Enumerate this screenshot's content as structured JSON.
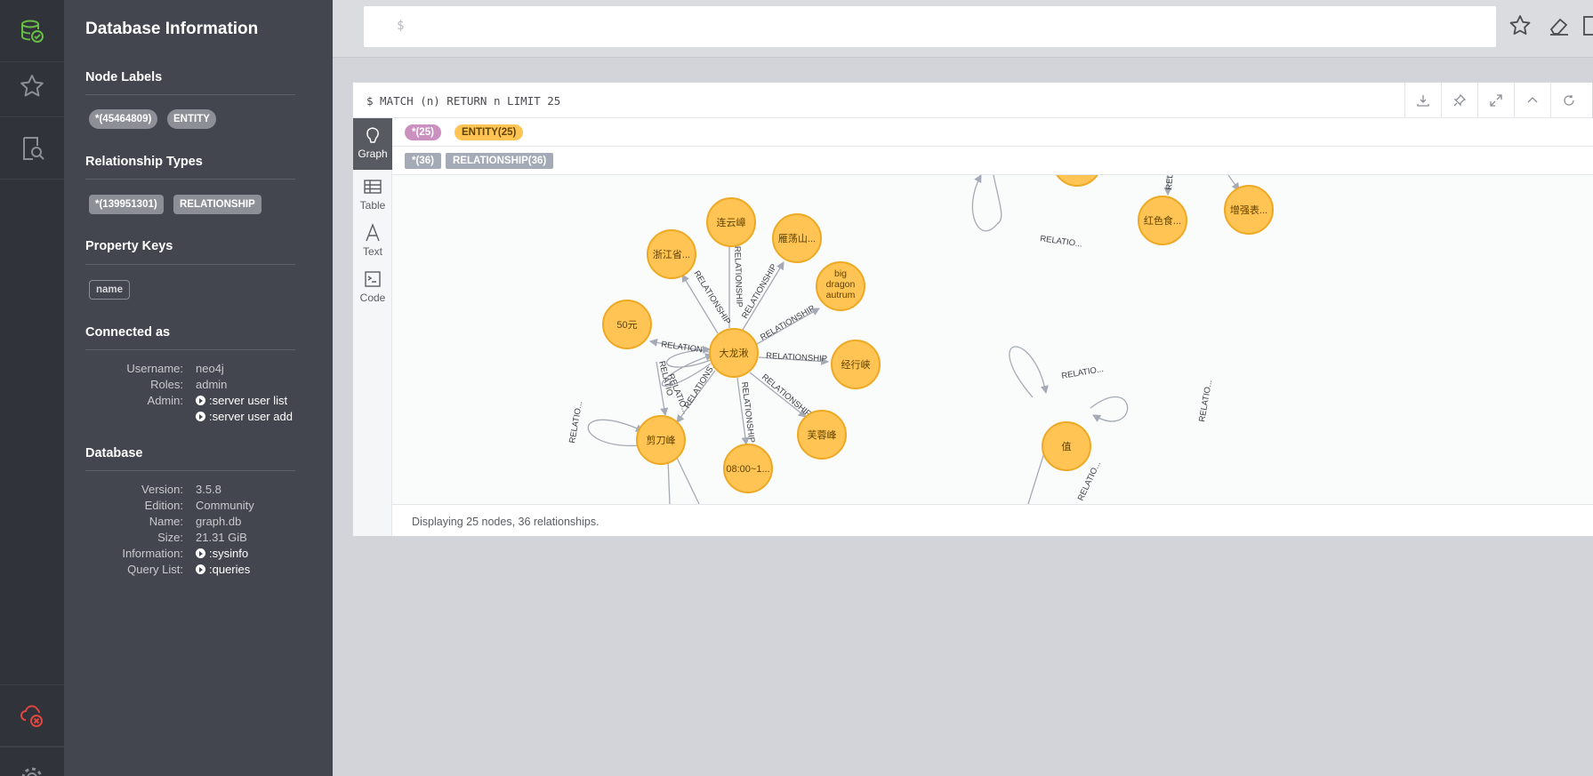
{
  "drawer": {
    "title": "Database Information",
    "node_labels_heading": "Node Labels",
    "node_labels": [
      "*(45464809)",
      "ENTITY"
    ],
    "relationship_types_heading": "Relationship Types",
    "relationship_types": [
      "*(139951301)",
      "RELATIONSHIP"
    ],
    "property_keys_heading": "Property Keys",
    "property_keys": [
      "name"
    ],
    "connected_heading": "Connected as",
    "connected": [
      {
        "k": "Username:",
        "v": "neo4j"
      },
      {
        "k": "Roles:",
        "v": "admin"
      },
      {
        "k": "Admin:",
        "v": ":server user list",
        "link": true
      },
      {
        "k": "",
        "v": ":server user add",
        "link": true
      }
    ],
    "database_heading": "Database",
    "database": [
      {
        "k": "Version:",
        "v": "3.5.8"
      },
      {
        "k": "Edition:",
        "v": "Community"
      },
      {
        "k": "Name:",
        "v": "graph.db"
      },
      {
        "k": "Size:",
        "v": "21.31 GiB"
      },
      {
        "k": "Information:",
        "v": ":sysinfo",
        "link": true
      },
      {
        "k": "Query List:",
        "v": ":queries",
        "link": true
      }
    ]
  },
  "rail": {
    "icons": [
      "database-icon",
      "star-icon",
      "documents-search-icon",
      "cloud-disconnected-icon",
      "gear-icon"
    ]
  },
  "editor": {
    "prompt": "$"
  },
  "frame": {
    "query": "$ MATCH (n) RETURN n LIMIT 25",
    "tabs": [
      "Graph",
      "Table",
      "Text",
      "Code"
    ],
    "legend_nodes": [
      {
        "label": "*(25)",
        "color": "#c990c0"
      },
      {
        "label": "ENTITY(25)",
        "color": "#ffc454"
      }
    ],
    "legend_rels": [
      {
        "label": "*(36)",
        "color": "#a5abb6"
      },
      {
        "label": "RELATIONSHIP(36)",
        "color": "#a5abb6"
      }
    ],
    "status": "Displaying 25 nodes, 36 relationships."
  },
  "graph": {
    "node_color": "#ffc454",
    "node_stroke": "#eda923",
    "nodes": [
      {
        "id": "center",
        "label": "大龙湫"
      },
      {
        "id": "n1",
        "label": "连云嶂"
      },
      {
        "id": "n2",
        "label": "雁荡山..."
      },
      {
        "id": "n3",
        "label": "浙江省..."
      },
      {
        "id": "n4",
        "label": "big dragon autrum"
      },
      {
        "id": "n5",
        "label": "50元"
      },
      {
        "id": "n6",
        "label": "经行峡"
      },
      {
        "id": "n7",
        "label": "剪刀峰"
      },
      {
        "id": "n8",
        "label": "08:00~1..."
      },
      {
        "id": "n9",
        "label": "芙蓉峰"
      },
      {
        "id": "n10",
        "label": "红色食..."
      },
      {
        "id": "n11",
        "label": "增强表..."
      },
      {
        "id": "n12",
        "label": "值"
      }
    ],
    "rel_label": "RELATIONSHIP",
    "rel_labels_short": [
      "RELATION",
      "RELATIO...",
      "RELATIONS...",
      "RELATIO",
      "REL"
    ]
  }
}
